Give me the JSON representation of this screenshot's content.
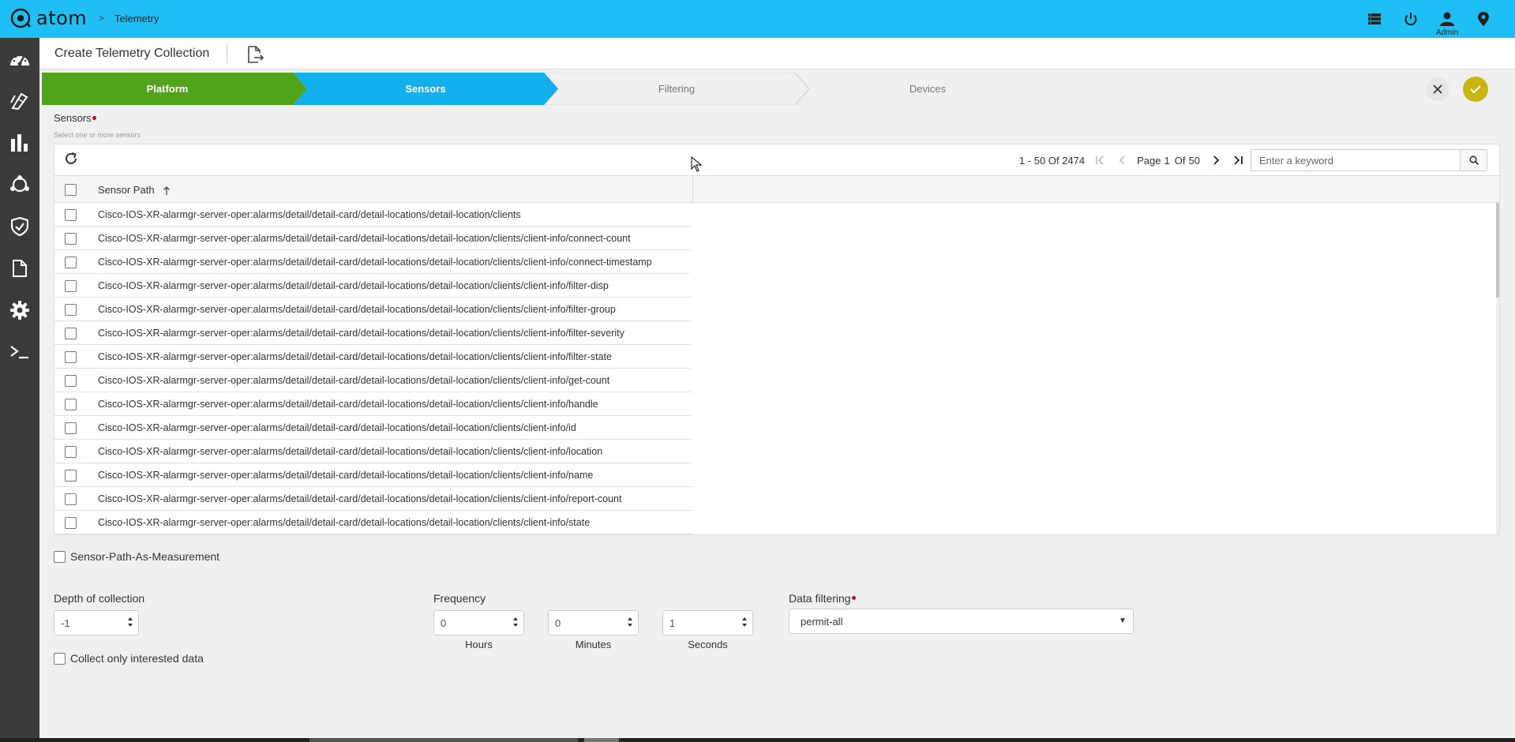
{
  "app": {
    "logo_text": "atom",
    "breadcrumb_sep": ">",
    "breadcrumb": "Telemetry",
    "admin_label": "Admin"
  },
  "header": {
    "title": "Create Telemetry Collection"
  },
  "steps": [
    {
      "label": "Platform",
      "state": "done"
    },
    {
      "label": "Sensors",
      "state": "active"
    },
    {
      "label": "Filtering",
      "state": "pending"
    },
    {
      "label": "Devices",
      "state": "pending"
    }
  ],
  "sensors": {
    "label": "Sensors",
    "hint": "Select one or more sensors"
  },
  "grid": {
    "range": "1 - 50 Of 2474",
    "page_label": "Page",
    "page": "1",
    "of_label": "Of",
    "total_pages": "50",
    "search_placeholder": "Enter a keyword",
    "column": "Sensor Path",
    "rows": [
      "Cisco-IOS-XR-alarmgr-server-oper:alarms/detail/detail-card/detail-locations/detail-location/clients",
      "Cisco-IOS-XR-alarmgr-server-oper:alarms/detail/detail-card/detail-locations/detail-location/clients/client-info/connect-count",
      "Cisco-IOS-XR-alarmgr-server-oper:alarms/detail/detail-card/detail-locations/detail-location/clients/client-info/connect-timestamp",
      "Cisco-IOS-XR-alarmgr-server-oper:alarms/detail/detail-card/detail-locations/detail-location/clients/client-info/filter-disp",
      "Cisco-IOS-XR-alarmgr-server-oper:alarms/detail/detail-card/detail-locations/detail-location/clients/client-info/filter-group",
      "Cisco-IOS-XR-alarmgr-server-oper:alarms/detail/detail-card/detail-locations/detail-location/clients/client-info/filter-severity",
      "Cisco-IOS-XR-alarmgr-server-oper:alarms/detail/detail-card/detail-locations/detail-location/clients/client-info/filter-state",
      "Cisco-IOS-XR-alarmgr-server-oper:alarms/detail/detail-card/detail-locations/detail-location/clients/client-info/get-count",
      "Cisco-IOS-XR-alarmgr-server-oper:alarms/detail/detail-card/detail-locations/detail-location/clients/client-info/handle",
      "Cisco-IOS-XR-alarmgr-server-oper:alarms/detail/detail-card/detail-locations/detail-location/clients/client-info/id",
      "Cisco-IOS-XR-alarmgr-server-oper:alarms/detail/detail-card/detail-locations/detail-location/clients/client-info/location",
      "Cisco-IOS-XR-alarmgr-server-oper:alarms/detail/detail-card/detail-locations/detail-location/clients/client-info/name",
      "Cisco-IOS-XR-alarmgr-server-oper:alarms/detail/detail-card/detail-locations/detail-location/clients/client-info/report-count",
      "Cisco-IOS-XR-alarmgr-server-oper:alarms/detail/detail-card/detail-locations/detail-location/clients/client-info/state"
    ]
  },
  "options": {
    "sensor_path_measurement": "Sensor-Path-As-Measurement",
    "depth_label": "Depth of collection",
    "depth_value": "-1",
    "frequency_label": "Frequency",
    "hours_value": "0",
    "hours_label": "Hours",
    "minutes_value": "0",
    "minutes_label": "Minutes",
    "seconds_value": "1",
    "seconds_label": "Seconds",
    "data_filtering_label": "Data filtering",
    "data_filtering_value": "permit-all",
    "collect_interested": "Collect only interested data"
  },
  "colors": {
    "topbar": "#1fbef5",
    "nav": "#3b3b3b",
    "step_done": "#52a31c",
    "step_active": "#12b1ee",
    "step_pending": "#f0f0f0",
    "confirm": "#c8b514",
    "required": "#d0021b"
  },
  "icons": {
    "logo": "atom-logo-icon",
    "topbar": [
      "server-list-icon",
      "power-icon",
      "user-icon",
      "location-pin-icon"
    ],
    "nav": [
      "dashboard-icon",
      "devices-icon",
      "analytics-icon",
      "topology-icon",
      "security-shield-icon",
      "document-icon",
      "settings-gear-icon",
      "terminal-icon"
    ]
  }
}
